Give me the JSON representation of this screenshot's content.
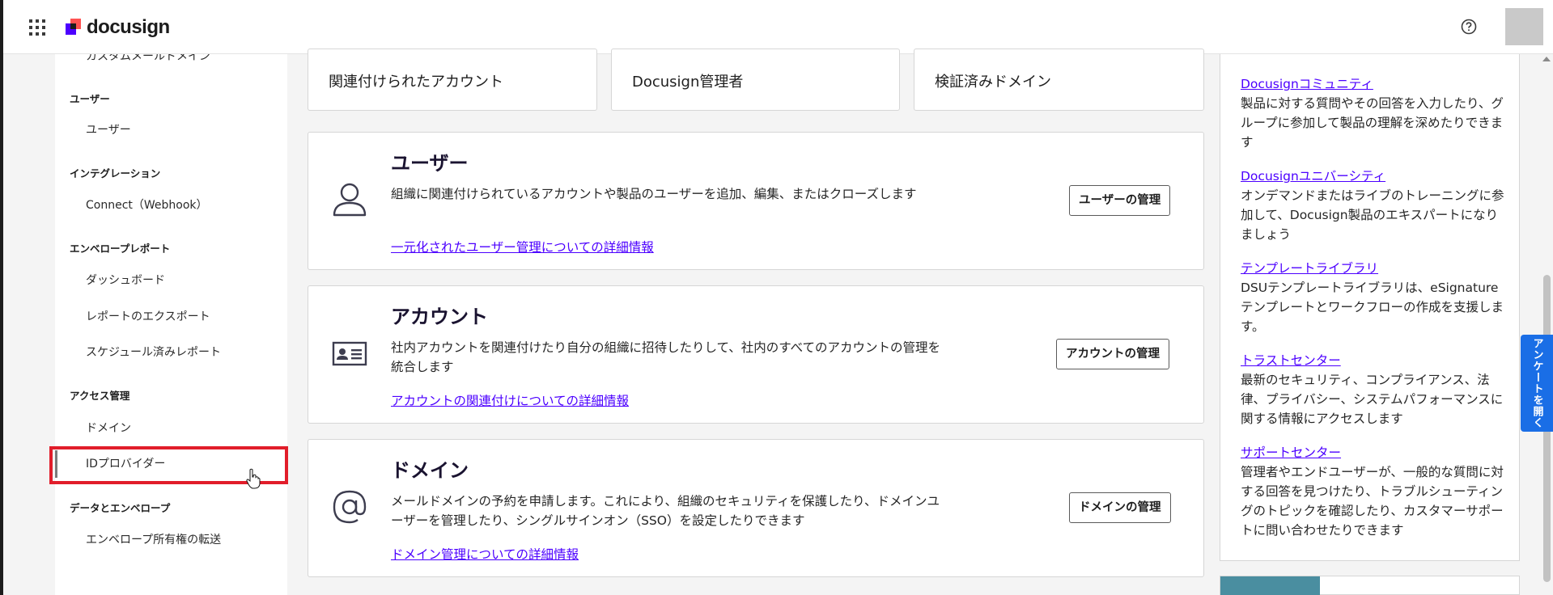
{
  "header": {
    "logo_text": "docusign",
    "apps_icon": "apps-grid-icon",
    "help_icon": "help-circle-icon"
  },
  "sidebar": {
    "cut_item": "カスタムメールドメイン",
    "sections": [
      {
        "heading": "ユーザー",
        "items": [
          "ユーザー"
        ]
      },
      {
        "heading": "インテグレーション",
        "items": [
          "Connect（Webhook）"
        ]
      },
      {
        "heading": "エンベロープレポート",
        "items": [
          "ダッシュボード",
          "レポートのエクスポート",
          "スケジュール済みレポート"
        ]
      },
      {
        "heading": "アクセス管理",
        "items": [
          "ドメイン",
          "IDプロバイダー"
        ]
      },
      {
        "heading": "データとエンベロープ",
        "items": [
          "エンベロープ所有権の転送"
        ]
      }
    ]
  },
  "top_cards": [
    "関連付けられたアカウント",
    "Docusign管理者",
    "検証済みドメイン"
  ],
  "features": [
    {
      "title": "ユーザー",
      "icon": "user-icon",
      "desc": "組織に関連付けられているアカウントや製品のユーザーを追加、編集、またはクローズします",
      "link": "一元化されたユーザー管理についての詳細情報",
      "button": "ユーザーの管理"
    },
    {
      "title": "アカウント",
      "icon": "id-card-icon",
      "desc": "社内アカウントを関連付けたり自分の組織に招待したりして、社内のすべてのアカウントの管理を統合します",
      "link": "アカウントの関連付けについての詳細情報",
      "button": "アカウントの管理"
    },
    {
      "title": "ドメイン",
      "icon": "at-sign-icon",
      "desc": "メールドメインの予約を申請します。これにより、組織のセキュリティを保護したり、ドメインユーザーを管理したり、シングルサインオン（SSO）を設定したりできます",
      "link": "ドメイン管理についての詳細情報",
      "button": "ドメインの管理"
    }
  ],
  "resources": [
    {
      "link": "Docusignコミュニティ",
      "desc": "製品に対する質問やその回答を入力したり、グループに参加して製品の理解を深めたりできます"
    },
    {
      "link": "Docusignユニバーシティ",
      "desc": "オンデマンドまたはライブのトレーニングに参加して、Docusign製品のエキスパートになりましょう"
    },
    {
      "link": "テンプレートライブラリ",
      "desc": "DSUテンプレートライブラリは、eSignatureテンプレートとワークフローの作成を支援します。"
    },
    {
      "link": "トラストセンター",
      "desc": "最新のセキュリティ、コンプライアンス、法律、プライバシー、システムパフォーマンスに関する情報にアクセスします"
    },
    {
      "link": "サポートセンター",
      "desc": "管理者やエンドユーザーが、一般的な質問に対する回答を見つけたり、トラブルシューティングのトピックを確認したり、カスタマーサポートに問い合わせたりできます"
    }
  ],
  "survey_tab": "アンケートを開く",
  "colors": {
    "brand_purple": "#4c00ff",
    "highlight_red": "#e11d2a",
    "survey_blue": "#1a6ee6"
  }
}
